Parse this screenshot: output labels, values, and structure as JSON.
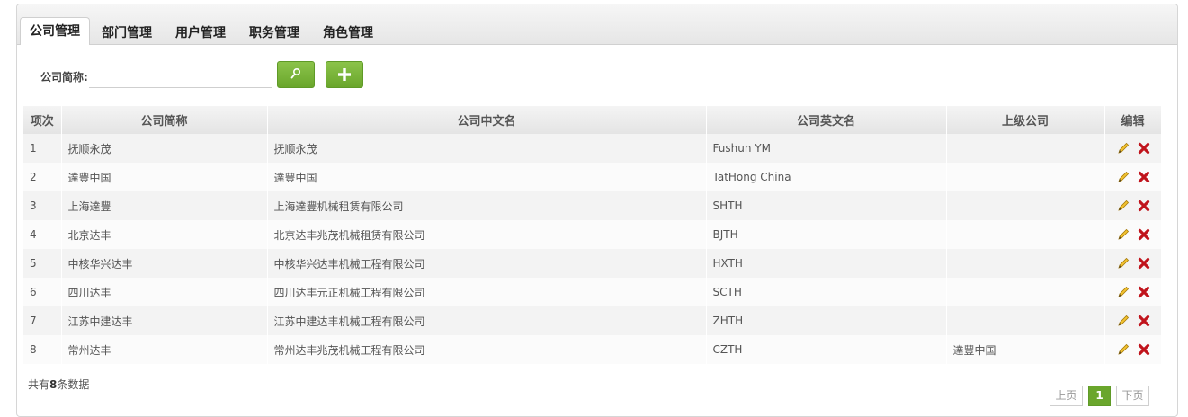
{
  "tabs": [
    "公司管理",
    "部门管理",
    "用户管理",
    "职务管理",
    "角色管理"
  ],
  "filter": {
    "label": "公司简称:",
    "value": ""
  },
  "buttons": {
    "search_icon": "search-icon",
    "add_icon": "plus-icon"
  },
  "table": {
    "headers": [
      "项次",
      "公司简称",
      "公司中文名",
      "公司英文名",
      "上级公司",
      "编辑"
    ],
    "rows": [
      [
        "1",
        "抚顺永茂",
        "抚顺永茂",
        "Fushun YM",
        ""
      ],
      [
        "2",
        "達豐中国",
        "達豐中国",
        "TatHong China",
        ""
      ],
      [
        "3",
        "上海達豐",
        "上海達豐机械租赁有限公司",
        "SHTH",
        ""
      ],
      [
        "4",
        "北京达丰",
        "北京达丰兆茂机械租赁有限公司",
        "BJTH",
        ""
      ],
      [
        "5",
        "中核华兴达丰",
        "中核华兴达丰机械工程有限公司",
        "HXTH",
        ""
      ],
      [
        "6",
        "四川达丰",
        "四川达丰元正机械工程有限公司",
        "SCTH",
        ""
      ],
      [
        "7",
        "江苏中建达丰",
        "江苏中建达丰机械工程有限公司",
        "ZHTH",
        ""
      ],
      [
        "8",
        "常州达丰",
        "常州达丰兆茂机械工程有限公司",
        "CZTH",
        "達豐中国"
      ]
    ]
  },
  "footer": {
    "total_prefix": "共有",
    "total_count": "8",
    "total_suffix": "条数据"
  },
  "pagination": {
    "prev": "上页",
    "current": "1",
    "next": "下页"
  },
  "colors": {
    "accent": "#6aa62c",
    "delete": "#c0141c",
    "edit": "#d4a017"
  }
}
